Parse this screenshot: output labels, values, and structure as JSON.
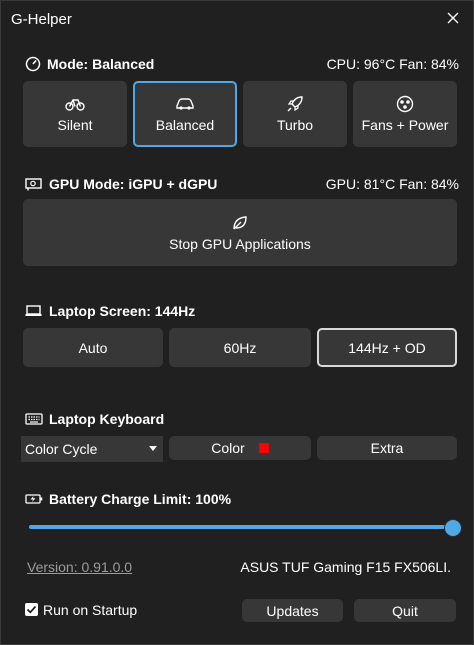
{
  "window": {
    "title": "G-Helper"
  },
  "mode": {
    "header": "Mode: Balanced",
    "stats": "CPU: 96°C Fan: 84%",
    "buttons": [
      {
        "label": "Silent",
        "icon": "bicycle-icon"
      },
      {
        "label": "Balanced",
        "icon": "car-icon",
        "selected": true
      },
      {
        "label": "Turbo",
        "icon": "rocket-icon"
      },
      {
        "label": "Fans + Power",
        "icon": "fan-icon"
      }
    ],
    "accent": "#4fa9e6"
  },
  "gpu": {
    "header": "GPU Mode: iGPU + dGPU",
    "stats": "GPU: 81°C Fan: 84%",
    "stop_button": "Stop GPU Applications",
    "stop_icon": "leaf-icon"
  },
  "screen": {
    "header": "Laptop Screen: 144Hz",
    "buttons": [
      {
        "label": "Auto"
      },
      {
        "label": "60Hz"
      },
      {
        "label": "144Hz + OD",
        "selected": true
      }
    ]
  },
  "keyboard": {
    "header": "Laptop Keyboard",
    "mode_value": "Color Cycle",
    "color_label": "Color",
    "color_value": "#ff0000",
    "extra_label": "Extra"
  },
  "battery": {
    "header": "Battery Charge Limit: 100%",
    "limit_percent": 100
  },
  "footer": {
    "version": "Version: 0.91.0.0",
    "model": "ASUS TUF Gaming F15 FX506LI.",
    "run_on_startup_label": "Run on Startup",
    "run_on_startup_checked": true,
    "updates_label": "Updates",
    "quit_label": "Quit"
  }
}
